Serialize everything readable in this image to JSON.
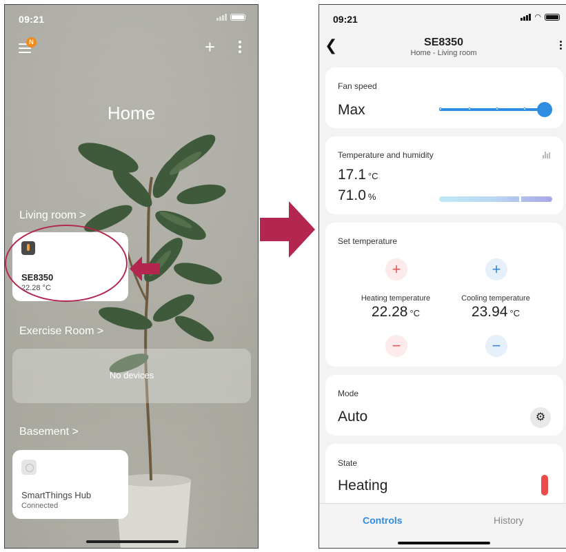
{
  "left": {
    "status_time": "09:21",
    "menu_badge": "N",
    "home_title": "Home",
    "rooms": [
      {
        "label": "Living room >"
      },
      {
        "label": "Exercise Room >"
      },
      {
        "label": "Basement >"
      }
    ],
    "device_card": {
      "name": "SE8350",
      "value": "22.28 °C",
      "icon": "thermostat-icon"
    },
    "no_devices": "No devices",
    "hub_card": {
      "name": "SmartThings Hub",
      "status": "Connected",
      "icon": "hub-icon"
    }
  },
  "right": {
    "status_time": "09:21",
    "nav": {
      "title": "SE8350",
      "subtitle": "Home - Living room"
    },
    "fan": {
      "label": "Fan speed",
      "value": "Max",
      "level_fraction": 1.0
    },
    "temp_humidity": {
      "label": "Temperature and humidity",
      "temperature": "17.1",
      "temp_unit": "°C",
      "humidity": "71.0",
      "hum_unit": "%",
      "humidity_level": 0.71
    },
    "set_temperature": {
      "label": "Set temperature",
      "heating_label": "Heating temperature",
      "heating_value": "22.28",
      "heating_unit": "°C",
      "cooling_label": "Cooling temperature",
      "cooling_value": "23.94",
      "cooling_unit": "°C",
      "plus": "+",
      "minus": "−"
    },
    "mode": {
      "label": "Mode",
      "value": "Auto"
    },
    "state": {
      "label": "State",
      "value": "Heating"
    },
    "tabs": {
      "controls": "Controls",
      "history": "History"
    }
  },
  "colors": {
    "accent": "#2e8de3",
    "annotation": "#b32650",
    "heating": "#ea4b4b"
  }
}
